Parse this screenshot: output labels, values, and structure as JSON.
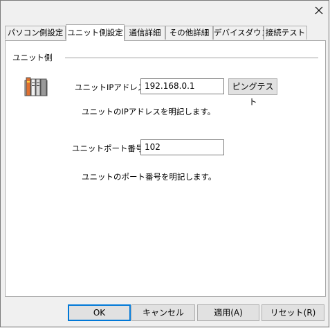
{
  "window": {
    "close_glyph": "✕"
  },
  "tabs": [
    {
      "label": "パソコン側設定",
      "active": false
    },
    {
      "label": "ユニット側設定",
      "active": true
    },
    {
      "label": "通信詳細",
      "active": false
    },
    {
      "label": "その他詳細",
      "active": false
    },
    {
      "label": "デバイスダウン",
      "active": false
    },
    {
      "label": "接続テスト",
      "active": false
    }
  ],
  "group": {
    "title": "ユニット側"
  },
  "ip": {
    "label": "ユニットIPアドレス：",
    "value": "192.168.0.1",
    "ping_button": "ピングテスト",
    "description": "ユニットのIPアドレスを明記します。"
  },
  "port": {
    "label": "ユニットポート番号：",
    "value": "102",
    "description": "ユニットのポート番号を明記します。"
  },
  "footer": {
    "ok": "OK",
    "cancel": "キャンセル",
    "apply": "適用(A)",
    "reset": "リセット(R)"
  },
  "colors": {
    "focus": "#0078d7",
    "button_face": "#e1e1e1",
    "panel": "#ffffff",
    "window": "#f0f0f0"
  },
  "icons": {
    "close": "close-icon",
    "device": "plc-unit-icon"
  }
}
